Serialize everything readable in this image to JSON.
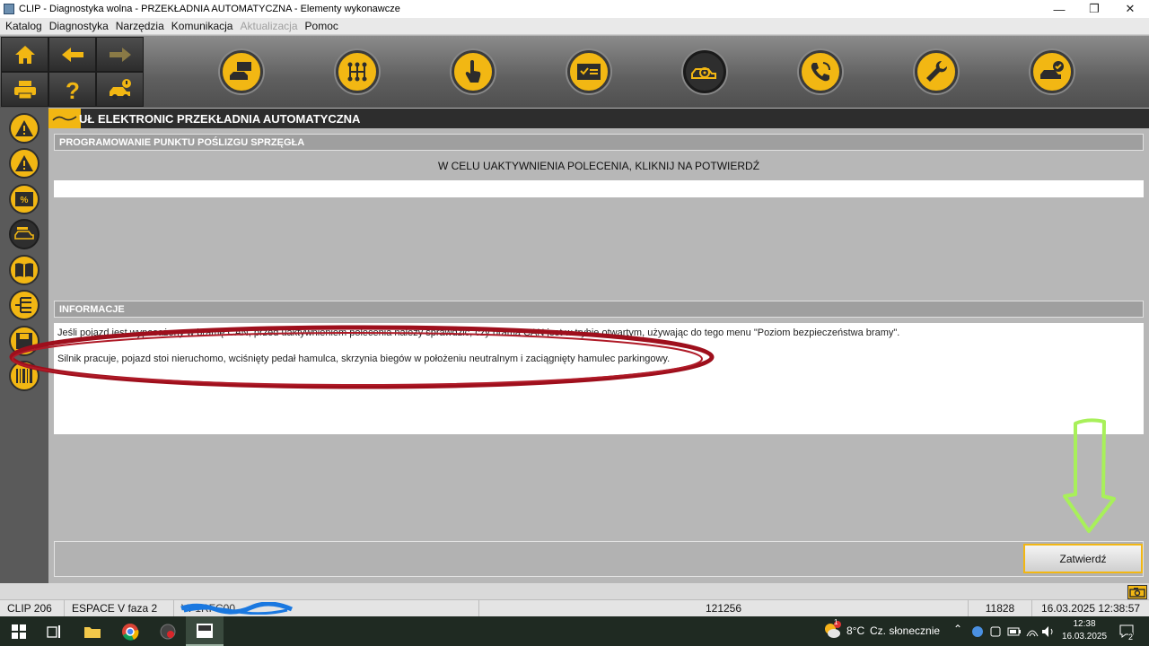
{
  "window": {
    "title": "CLIP - Diagnostyka wolna - PRZEKŁADNIA AUTOMATYCZNA - Elementy wykonawcze",
    "minimize": "—",
    "maximize": "❐",
    "close": "✕"
  },
  "menu": {
    "items": [
      {
        "label": "Katalog",
        "enabled": true
      },
      {
        "label": "Diagnostyka",
        "enabled": true
      },
      {
        "label": "Narzędzia",
        "enabled": true
      },
      {
        "label": "Komunikacja",
        "enabled": true
      },
      {
        "label": "Aktualizacja",
        "enabled": false
      },
      {
        "label": "Pomoc",
        "enabled": true
      }
    ]
  },
  "toolbar": {
    "nav_icons": [
      "home-icon",
      "back-arrow-icon",
      "forward-arrow-icon",
      "printer-icon",
      "help-icon",
      "car-alert-icon"
    ],
    "function_icons": [
      "vehicle-identification-icon",
      "gearbox-icon",
      "touch-action-icon",
      "checklist-icon",
      "actuator-test-icon",
      "remote-call-icon",
      "repair-wrench-icon",
      "vehicle-check-icon"
    ],
    "active_function": "actuator-test-icon"
  },
  "sidebar": {
    "icons": [
      "warning-icon",
      "warning-icon-2",
      "percent-parameters-icon",
      "vehicle-actuators-icon",
      "manual-book-icon",
      "wiring-icon",
      "save-icon",
      "barcode-icon"
    ],
    "active": "vehicle-actuators-icon"
  },
  "header": {
    "title": "UŁ ELEKTRONIC PRZEKŁADNIA AUTOMATYCZNA"
  },
  "command": {
    "section_title": "PROGRAMOWANIE PUNKTU POŚLIZGU SPRZĘGŁA",
    "instruction": "W CELU UAKTYWNIENIA POLECENIA, KLIKNIJ NA POTWIERDŹ"
  },
  "info": {
    "section_title": "INFORMACJE",
    "line1": "Jeśli pojazd jest wyposażony w bramę CAN, przed uaktywnieniem polecenia należy sprawdzić, czy brama CAN jest w trybie otwartym, używając do tego menu \"Poziom bezpieczeństwa bramy\".",
    "line2": "Silnik pracuje, pojazd stoi nieruchomo, wciśnięty pedał hamulca, skrzynia biegów w położeniu neutralnym i zaciągnięty hamulec parkingowy."
  },
  "confirm_button": "Zatwierdź",
  "status": {
    "tool": "CLIP 206",
    "vehicle": "ESPACE V faza 2",
    "vin": "VF1RFC00…",
    "code": "121256",
    "counter": "11828",
    "datetime": "16.03.2025 12:38:57"
  },
  "taskbar": {
    "weather_temp": "8°C",
    "weather_text": "Cz. słonecznie",
    "weather_badge": "1",
    "time": "12:38",
    "date": "16.03.2025",
    "notifications": "2"
  },
  "colors": {
    "accent_yellow": "#f2b713",
    "annotation_red": "#9e0f1c",
    "annotation_green": "#a8f05a"
  }
}
